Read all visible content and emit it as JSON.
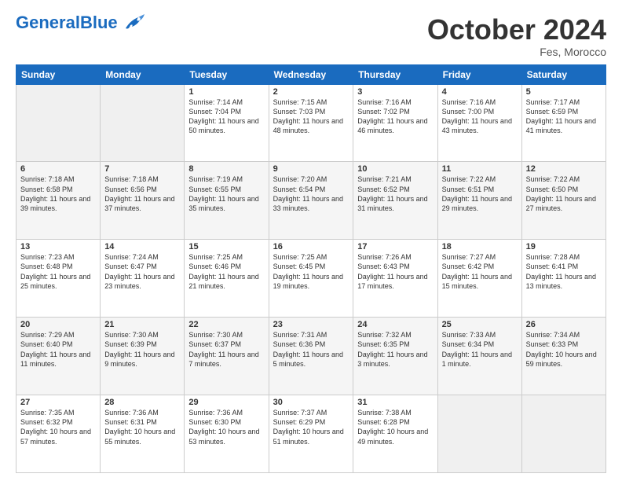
{
  "header": {
    "logo_general": "General",
    "logo_blue": "Blue",
    "month": "October 2024",
    "location": "Fes, Morocco"
  },
  "days_of_week": [
    "Sunday",
    "Monday",
    "Tuesday",
    "Wednesday",
    "Thursday",
    "Friday",
    "Saturday"
  ],
  "weeks": [
    [
      {
        "day": "",
        "sunrise": "",
        "sunset": "",
        "daylight": ""
      },
      {
        "day": "",
        "sunrise": "",
        "sunset": "",
        "daylight": ""
      },
      {
        "day": "1",
        "sunrise": "Sunrise: 7:14 AM",
        "sunset": "Sunset: 7:04 PM",
        "daylight": "Daylight: 11 hours and 50 minutes."
      },
      {
        "day": "2",
        "sunrise": "Sunrise: 7:15 AM",
        "sunset": "Sunset: 7:03 PM",
        "daylight": "Daylight: 11 hours and 48 minutes."
      },
      {
        "day": "3",
        "sunrise": "Sunrise: 7:16 AM",
        "sunset": "Sunset: 7:02 PM",
        "daylight": "Daylight: 11 hours and 46 minutes."
      },
      {
        "day": "4",
        "sunrise": "Sunrise: 7:16 AM",
        "sunset": "Sunset: 7:00 PM",
        "daylight": "Daylight: 11 hours and 43 minutes."
      },
      {
        "day": "5",
        "sunrise": "Sunrise: 7:17 AM",
        "sunset": "Sunset: 6:59 PM",
        "daylight": "Daylight: 11 hours and 41 minutes."
      }
    ],
    [
      {
        "day": "6",
        "sunrise": "Sunrise: 7:18 AM",
        "sunset": "Sunset: 6:58 PM",
        "daylight": "Daylight: 11 hours and 39 minutes."
      },
      {
        "day": "7",
        "sunrise": "Sunrise: 7:18 AM",
        "sunset": "Sunset: 6:56 PM",
        "daylight": "Daylight: 11 hours and 37 minutes."
      },
      {
        "day": "8",
        "sunrise": "Sunrise: 7:19 AM",
        "sunset": "Sunset: 6:55 PM",
        "daylight": "Daylight: 11 hours and 35 minutes."
      },
      {
        "day": "9",
        "sunrise": "Sunrise: 7:20 AM",
        "sunset": "Sunset: 6:54 PM",
        "daylight": "Daylight: 11 hours and 33 minutes."
      },
      {
        "day": "10",
        "sunrise": "Sunrise: 7:21 AM",
        "sunset": "Sunset: 6:52 PM",
        "daylight": "Daylight: 11 hours and 31 minutes."
      },
      {
        "day": "11",
        "sunrise": "Sunrise: 7:22 AM",
        "sunset": "Sunset: 6:51 PM",
        "daylight": "Daylight: 11 hours and 29 minutes."
      },
      {
        "day": "12",
        "sunrise": "Sunrise: 7:22 AM",
        "sunset": "Sunset: 6:50 PM",
        "daylight": "Daylight: 11 hours and 27 minutes."
      }
    ],
    [
      {
        "day": "13",
        "sunrise": "Sunrise: 7:23 AM",
        "sunset": "Sunset: 6:48 PM",
        "daylight": "Daylight: 11 hours and 25 minutes."
      },
      {
        "day": "14",
        "sunrise": "Sunrise: 7:24 AM",
        "sunset": "Sunset: 6:47 PM",
        "daylight": "Daylight: 11 hours and 23 minutes."
      },
      {
        "day": "15",
        "sunrise": "Sunrise: 7:25 AM",
        "sunset": "Sunset: 6:46 PM",
        "daylight": "Daylight: 11 hours and 21 minutes."
      },
      {
        "day": "16",
        "sunrise": "Sunrise: 7:25 AM",
        "sunset": "Sunset: 6:45 PM",
        "daylight": "Daylight: 11 hours and 19 minutes."
      },
      {
        "day": "17",
        "sunrise": "Sunrise: 7:26 AM",
        "sunset": "Sunset: 6:43 PM",
        "daylight": "Daylight: 11 hours and 17 minutes."
      },
      {
        "day": "18",
        "sunrise": "Sunrise: 7:27 AM",
        "sunset": "Sunset: 6:42 PM",
        "daylight": "Daylight: 11 hours and 15 minutes."
      },
      {
        "day": "19",
        "sunrise": "Sunrise: 7:28 AM",
        "sunset": "Sunset: 6:41 PM",
        "daylight": "Daylight: 11 hours and 13 minutes."
      }
    ],
    [
      {
        "day": "20",
        "sunrise": "Sunrise: 7:29 AM",
        "sunset": "Sunset: 6:40 PM",
        "daylight": "Daylight: 11 hours and 11 minutes."
      },
      {
        "day": "21",
        "sunrise": "Sunrise: 7:30 AM",
        "sunset": "Sunset: 6:39 PM",
        "daylight": "Daylight: 11 hours and 9 minutes."
      },
      {
        "day": "22",
        "sunrise": "Sunrise: 7:30 AM",
        "sunset": "Sunset: 6:37 PM",
        "daylight": "Daylight: 11 hours and 7 minutes."
      },
      {
        "day": "23",
        "sunrise": "Sunrise: 7:31 AM",
        "sunset": "Sunset: 6:36 PM",
        "daylight": "Daylight: 11 hours and 5 minutes."
      },
      {
        "day": "24",
        "sunrise": "Sunrise: 7:32 AM",
        "sunset": "Sunset: 6:35 PM",
        "daylight": "Daylight: 11 hours and 3 minutes."
      },
      {
        "day": "25",
        "sunrise": "Sunrise: 7:33 AM",
        "sunset": "Sunset: 6:34 PM",
        "daylight": "Daylight: 11 hours and 1 minute."
      },
      {
        "day": "26",
        "sunrise": "Sunrise: 7:34 AM",
        "sunset": "Sunset: 6:33 PM",
        "daylight": "Daylight: 10 hours and 59 minutes."
      }
    ],
    [
      {
        "day": "27",
        "sunrise": "Sunrise: 7:35 AM",
        "sunset": "Sunset: 6:32 PM",
        "daylight": "Daylight: 10 hours and 57 minutes."
      },
      {
        "day": "28",
        "sunrise": "Sunrise: 7:36 AM",
        "sunset": "Sunset: 6:31 PM",
        "daylight": "Daylight: 10 hours and 55 minutes."
      },
      {
        "day": "29",
        "sunrise": "Sunrise: 7:36 AM",
        "sunset": "Sunset: 6:30 PM",
        "daylight": "Daylight: 10 hours and 53 minutes."
      },
      {
        "day": "30",
        "sunrise": "Sunrise: 7:37 AM",
        "sunset": "Sunset: 6:29 PM",
        "daylight": "Daylight: 10 hours and 51 minutes."
      },
      {
        "day": "31",
        "sunrise": "Sunrise: 7:38 AM",
        "sunset": "Sunset: 6:28 PM",
        "daylight": "Daylight: 10 hours and 49 minutes."
      },
      {
        "day": "",
        "sunrise": "",
        "sunset": "",
        "daylight": ""
      },
      {
        "day": "",
        "sunrise": "",
        "sunset": "",
        "daylight": ""
      }
    ]
  ]
}
